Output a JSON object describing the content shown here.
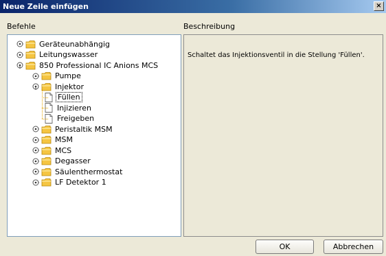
{
  "window": {
    "title": "Neue Zeile einfügen",
    "close_symbol": "×"
  },
  "left": {
    "label": "Befehle"
  },
  "right": {
    "label": "Beschreibung",
    "description": "Schaltet das Injektionsventil in die Stellung 'Füllen'."
  },
  "tree": {
    "items": [
      {
        "label": "Geräteunabhängig"
      },
      {
        "label": "Leitungswasser"
      },
      {
        "label": "850 Professional IC Anions MCS"
      },
      {
        "label": "Pumpe"
      },
      {
        "label": "Injektor"
      },
      {
        "label": "Füllen"
      },
      {
        "label": "Injizieren"
      },
      {
        "label": "Freigeben"
      },
      {
        "label": "Peristaltik MSM"
      },
      {
        "label": "MSM"
      },
      {
        "label": "MCS"
      },
      {
        "label": "Degasser"
      },
      {
        "label": "Säulenthermostat"
      },
      {
        "label": "LF Detektor 1"
      }
    ]
  },
  "buttons": {
    "ok": "OK",
    "cancel": "Abbrechen"
  },
  "colors": {
    "folder": "#f5c542",
    "tree_line": "#e6a400",
    "title_start": "#0a246a"
  }
}
